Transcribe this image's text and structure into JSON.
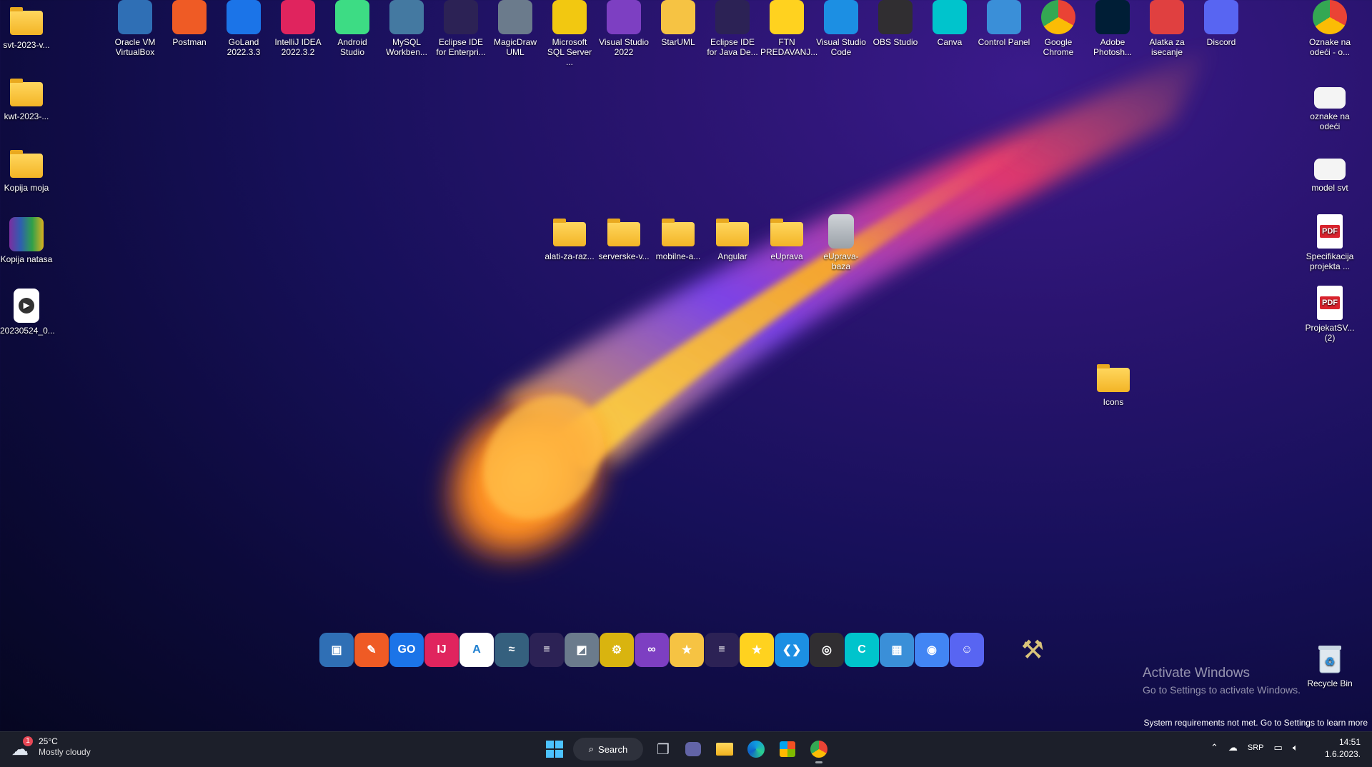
{
  "desktop": {
    "top_icons": [
      {
        "label": "Oracle VM VirtualBox",
        "icon": "virtualbox-icon",
        "color": "#2f6fb5"
      },
      {
        "label": "Postman",
        "icon": "postman-icon",
        "color": "#ef5b25"
      },
      {
        "label": "GoLand 2022.3.3",
        "icon": "goland-icon",
        "color": "#1b74e8"
      },
      {
        "label": "IntelliJ IDEA 2022.3.2",
        "icon": "intellij-icon",
        "color": "#e0245e"
      },
      {
        "label": "Android Studio",
        "icon": "android-studio-icon",
        "color": "#3ddc84"
      },
      {
        "label": "MySQL Workben...",
        "icon": "mysql-workbench-icon",
        "color": "#4479a1"
      },
      {
        "label": "Eclipse IDE for Enterpri...",
        "icon": "eclipse-icon",
        "color": "#2c2255"
      },
      {
        "label": "MagicDraw UML",
        "icon": "magicdraw-icon",
        "color": "#6b7b8c"
      },
      {
        "label": "Microsoft SQL Server ...",
        "icon": "sql-server-icon",
        "color": "#f2c811"
      },
      {
        "label": "Visual Studio 2022",
        "icon": "visual-studio-icon",
        "color": "#7d3fc2"
      },
      {
        "label": "StarUML",
        "icon": "staruml-icon",
        "color": "#f6c343"
      },
      {
        "label": "Eclipse IDE for Java De...",
        "icon": "eclipse-java-icon",
        "color": "#2c2255"
      },
      {
        "label": "FTN PREDAVANJ...",
        "icon": "star-icon",
        "color": "#ffd21f"
      },
      {
        "label": "Visual Studio Code",
        "icon": "vscode-icon",
        "color": "#1c8fe3"
      },
      {
        "label": "OBS Studio",
        "icon": "obs-icon",
        "color": "#302e31"
      },
      {
        "label": "Canva",
        "icon": "canva-icon",
        "color": "#00c4cc"
      },
      {
        "label": "Control Panel",
        "icon": "control-panel-icon",
        "color": "#3a8fd8"
      },
      {
        "label": "Google Chrome",
        "icon": "chrome-icon",
        "color": "#4285f4"
      },
      {
        "label": "Adobe Photosh...",
        "icon": "photoshop-icon",
        "color": "#001e36"
      },
      {
        "label": "Alatka za isecanje",
        "icon": "snipping-tool-icon",
        "color": "#e04040"
      },
      {
        "label": "Discord",
        "icon": "discord-icon",
        "color": "#5865f2"
      }
    ],
    "left_icons": [
      {
        "label": "svt-2023-v...",
        "icon": "folder-icon"
      },
      {
        "label": "kwt-2023-...",
        "icon": "folder-icon"
      },
      {
        "label": "Kopija moja",
        "icon": "folder-icon"
      },
      {
        "label": "Kopija natasa",
        "icon": "winrar-icon"
      },
      {
        "label": "20230524_0...",
        "icon": "video-file-icon"
      }
    ],
    "center_icons": [
      {
        "label": "alati-za-raz...",
        "icon": "folder-icon"
      },
      {
        "label": "serverske-v...",
        "icon": "folder-icon"
      },
      {
        "label": "mobilne-a...",
        "icon": "folder-icon"
      },
      {
        "label": "Angular",
        "icon": "folder-icon"
      },
      {
        "label": "eUprava",
        "icon": "folder-icon"
      },
      {
        "label": "eUprava-baza",
        "icon": "file-icon"
      }
    ],
    "right_icons": [
      {
        "label": "Oznake na odeći - o...",
        "icon": "chrome-icon"
      },
      {
        "label": "oznake na odeći",
        "icon": "image-file-icon"
      },
      {
        "label": "model svt",
        "icon": "image-file-icon"
      },
      {
        "label": "Specifikacija projekta ...",
        "icon": "pdf-icon"
      },
      {
        "label": "ProjekatSV... (2)",
        "icon": "pdf-icon"
      }
    ],
    "icons_folder": {
      "label": "Icons",
      "icon": "folder-icon"
    },
    "recycle_bin": {
      "label": "Recycle Bin",
      "icon": "recycle-bin-icon"
    }
  },
  "dock": {
    "items": [
      {
        "icon": "virtualbox-icon",
        "color": "#2f6fb5",
        "glyph": "▣"
      },
      {
        "icon": "postman-icon",
        "color": "#ef5b25",
        "glyph": "✎"
      },
      {
        "icon": "goland-icon",
        "color": "#1b74e8",
        "glyph": "GO"
      },
      {
        "icon": "intellij-icon",
        "color": "#e0245e",
        "glyph": "IJ"
      },
      {
        "icon": "android-studio-icon",
        "color": "#ffffff",
        "glyph": "A"
      },
      {
        "icon": "mysql-workbench-icon",
        "color": "#35607e",
        "glyph": "≈"
      },
      {
        "icon": "eclipse-icon",
        "color": "#2c2255",
        "glyph": "≡"
      },
      {
        "icon": "magicdraw-icon",
        "color": "#6b7b8c",
        "glyph": "◩"
      },
      {
        "icon": "sql-server-icon",
        "color": "#d9b40f",
        "glyph": "⚙"
      },
      {
        "icon": "visual-studio-icon",
        "color": "#7d3fc2",
        "glyph": "∞"
      },
      {
        "icon": "staruml-icon",
        "color": "#f6c343",
        "glyph": "★"
      },
      {
        "icon": "eclipse-java-icon",
        "color": "#2c2255",
        "glyph": "≡"
      },
      {
        "icon": "star-icon",
        "color": "#ffd21f",
        "glyph": "★"
      },
      {
        "icon": "vscode-icon",
        "color": "#1c8fe3",
        "glyph": "❮❯"
      },
      {
        "icon": "obs-icon",
        "color": "#302e31",
        "glyph": "◎"
      },
      {
        "icon": "canva-icon",
        "color": "#00c4cc",
        "glyph": "C"
      },
      {
        "icon": "control-panel-icon",
        "color": "#3a8fd8",
        "glyph": "▦"
      },
      {
        "icon": "chrome-icon",
        "color": "#4285f4",
        "glyph": "◉"
      },
      {
        "icon": "discord-icon",
        "color": "#5865f2",
        "glyph": "☺"
      }
    ],
    "tools_icon": {
      "icon": "tools-icon",
      "glyph": "⚒"
    }
  },
  "watermark": {
    "line1": "Activate Windows",
    "line2": "Go to Settings to activate Windows."
  },
  "system_requirements": "System requirements not met. Go to Settings to learn more",
  "taskbar": {
    "weather": {
      "temp": "25°C",
      "condition": "Mostly cloudy",
      "badge": "1"
    },
    "search_label": "Search",
    "language": "SRP",
    "time": "14:51",
    "date": "1.6.2023."
  }
}
